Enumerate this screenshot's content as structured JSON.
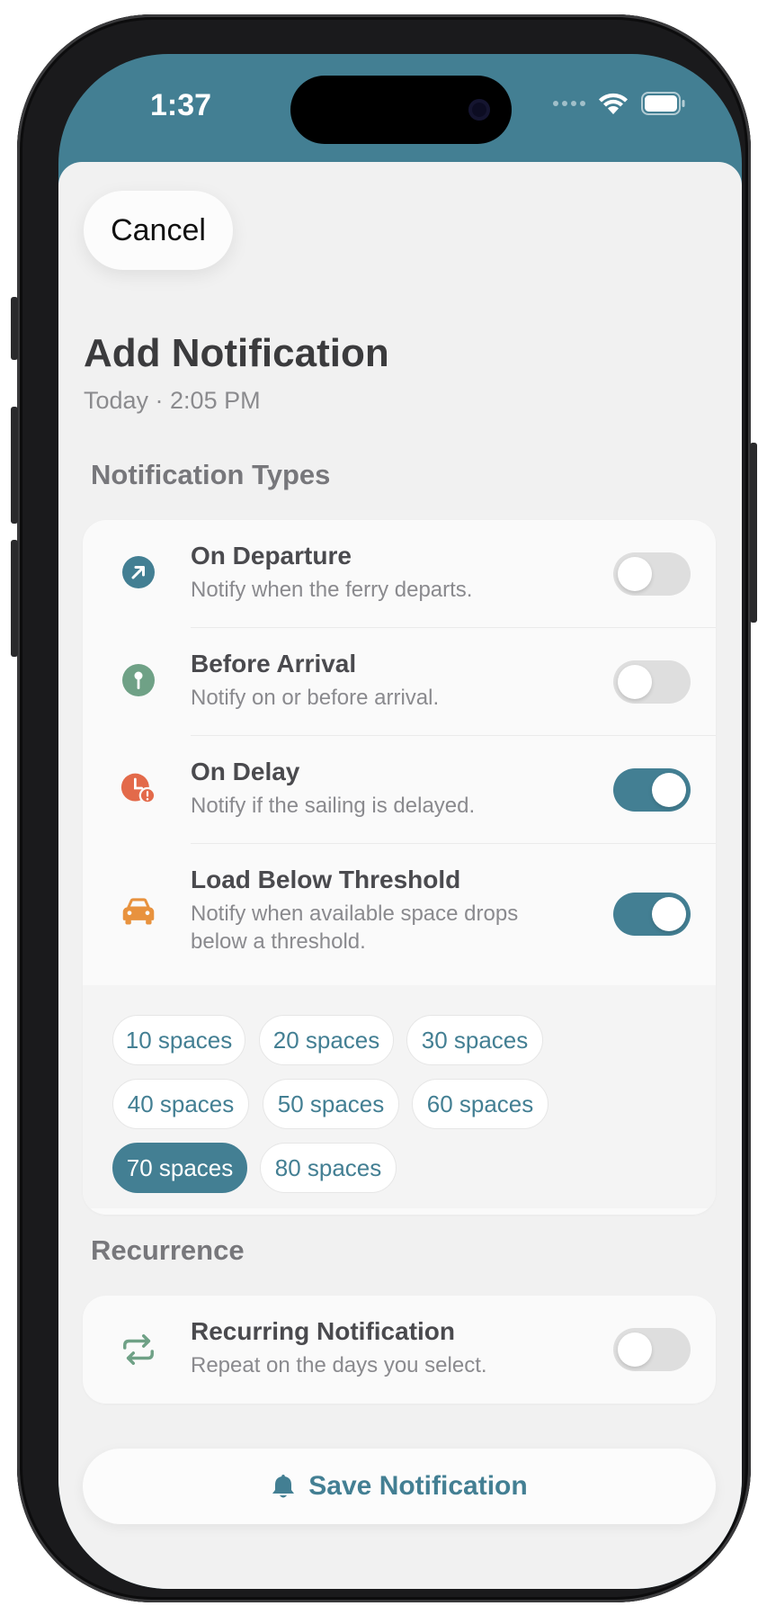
{
  "status_bar": {
    "time": "1:37"
  },
  "header": {
    "cancel_label": "Cancel",
    "title": "Add Notification",
    "subtitle": "Today · 2:05 PM"
  },
  "notification_types": {
    "section_label": "Notification Types",
    "items": [
      {
        "title": "On Departure",
        "description": "Notify when the ferry departs.",
        "icon": "arrow-up-right-icon",
        "enabled": false
      },
      {
        "title": "Before Arrival",
        "description": "Notify on or before arrival.",
        "icon": "pin-icon",
        "enabled": false
      },
      {
        "title": "On Delay",
        "description": "Notify if the sailing is delayed.",
        "icon": "clock-alert-icon",
        "enabled": true
      },
      {
        "title": "Load Below Threshold",
        "description": "Notify when available space drops below a threshold.",
        "icon": "car-icon",
        "enabled": true
      }
    ],
    "thresholds": [
      "10 spaces",
      "20 spaces",
      "30 spaces",
      "40 spaces",
      "50 spaces",
      "60 spaces",
      "70 spaces",
      "80 spaces"
    ],
    "selected_threshold": "70 spaces"
  },
  "recurrence": {
    "section_label": "Recurrence",
    "title": "Recurring Notification",
    "description": "Repeat on the days you select.",
    "icon": "repeat-icon",
    "enabled": false
  },
  "save_label": "Save Notification",
  "colors": {
    "accent": "#437f93",
    "departure_icon": "#437f93",
    "arrival_icon": "#6fa186",
    "delay_icon": "#e36a4a",
    "load_icon": "#e8923e",
    "recurrence_icon": "#6fa186"
  }
}
